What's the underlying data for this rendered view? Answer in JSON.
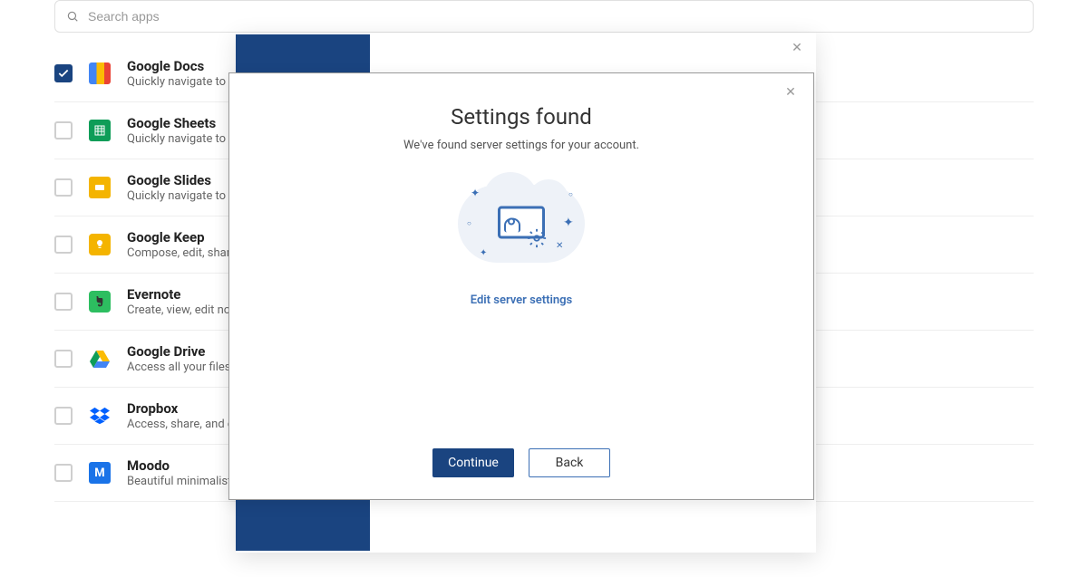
{
  "search": {
    "placeholder": "Search apps"
  },
  "apps": [
    {
      "name": "Google Docs",
      "desc": "Quickly navigate to your recent docs from anywhere",
      "checked": true
    },
    {
      "name": "Google Sheets",
      "desc": "Quickly navigate to your recent sheets from anywhere",
      "checked": false
    },
    {
      "name": "Google Slides",
      "desc": "Quickly navigate to your recent presentations from anywhere",
      "checked": false
    },
    {
      "name": "Google Keep",
      "desc": "Compose, edit, share notes from anywhere",
      "checked": false
    },
    {
      "name": "Evernote",
      "desc": "Create, view, edit notes from anywhere",
      "checked": false
    },
    {
      "name": "Google Drive",
      "desc": "Access all your files in one place",
      "checked": false
    },
    {
      "name": "Dropbox",
      "desc": "Access, share, and organize your files",
      "checked": false
    },
    {
      "name": "Moodo",
      "desc": "Beautiful minimalistic task manager",
      "checked": false
    }
  ],
  "modal": {
    "title": "Settings found",
    "subtitle": "We've found server settings for your account.",
    "edit_link": "Edit server settings",
    "continue": "Continue",
    "back": "Back"
  }
}
